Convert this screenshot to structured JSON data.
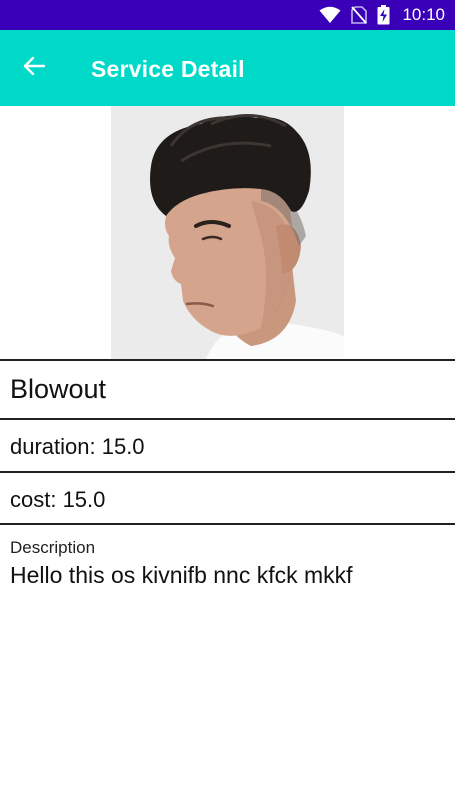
{
  "status_bar": {
    "time": "10:10",
    "icons": [
      "wifi-icon",
      "no-sim-icon",
      "battery-charging-icon"
    ]
  },
  "app_bar": {
    "title": "Service Detail",
    "back_icon": "arrow-left-icon"
  },
  "hero_image": {
    "subject": "man-portrait"
  },
  "service": {
    "name": "Blowout",
    "duration_text": "duration: 15.0",
    "cost_text": "cost: 15.0",
    "description_label": "Description",
    "description_text": "Hello this os kivnifb nnc kfck mkkf"
  },
  "colors": {
    "status_bar": "#3a00b8",
    "app_bar": "#00d8c8",
    "divider": "#222222",
    "background": "#ffffff"
  }
}
